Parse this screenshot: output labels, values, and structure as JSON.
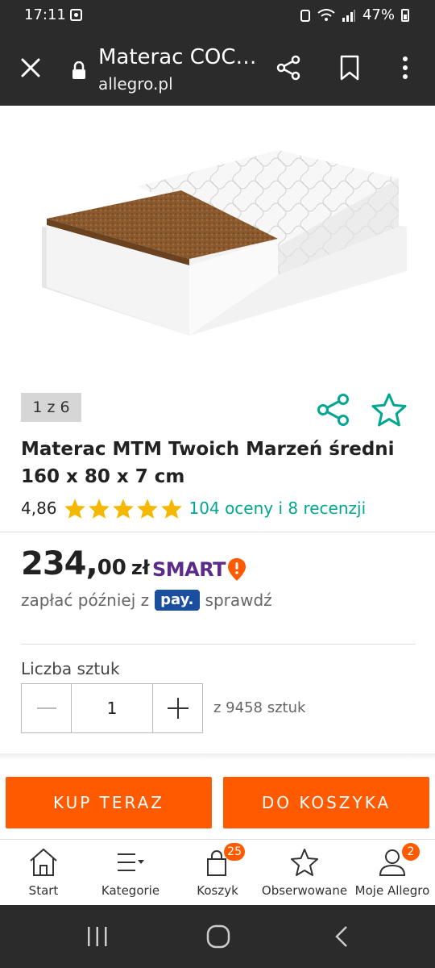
{
  "status_bar": {
    "time": "17:11",
    "battery": "47%"
  },
  "browser": {
    "title": "Materac COC…",
    "url": "allegro.pl"
  },
  "gallery": {
    "counter": "1 z 6"
  },
  "product": {
    "title": "Materac MTM Twoich Marzeń średni 160 x 80 x 7 cm",
    "rating_value": "4,86",
    "stars": 5,
    "rating_link": "104 oceny i 8 recenzji"
  },
  "price": {
    "main": "234,",
    "decimal": "00",
    "currency": "zł",
    "smart_label": "SMART"
  },
  "pay_later": {
    "prefix": "zapłać później z",
    "badge": "pay.",
    "suffix": "sprawdź"
  },
  "quantity": {
    "label": "Liczba sztuk",
    "value": "1",
    "available": "z 9458 sztuk"
  },
  "actions": {
    "buy_now": "KUP TERAZ",
    "add_to_cart": "DO KOSZYKA"
  },
  "bottom_nav": {
    "start": "Start",
    "categories": "Kategorie",
    "cart": "Koszyk",
    "cart_badge": "25",
    "watched": "Obserwowane",
    "my_allegro": "Moje Allegro",
    "my_allegro_badge": "2"
  },
  "colors": {
    "accent": "#ff5a00",
    "link": "#00a790",
    "star": "#f5b800",
    "smart": "#5a2b8a"
  }
}
